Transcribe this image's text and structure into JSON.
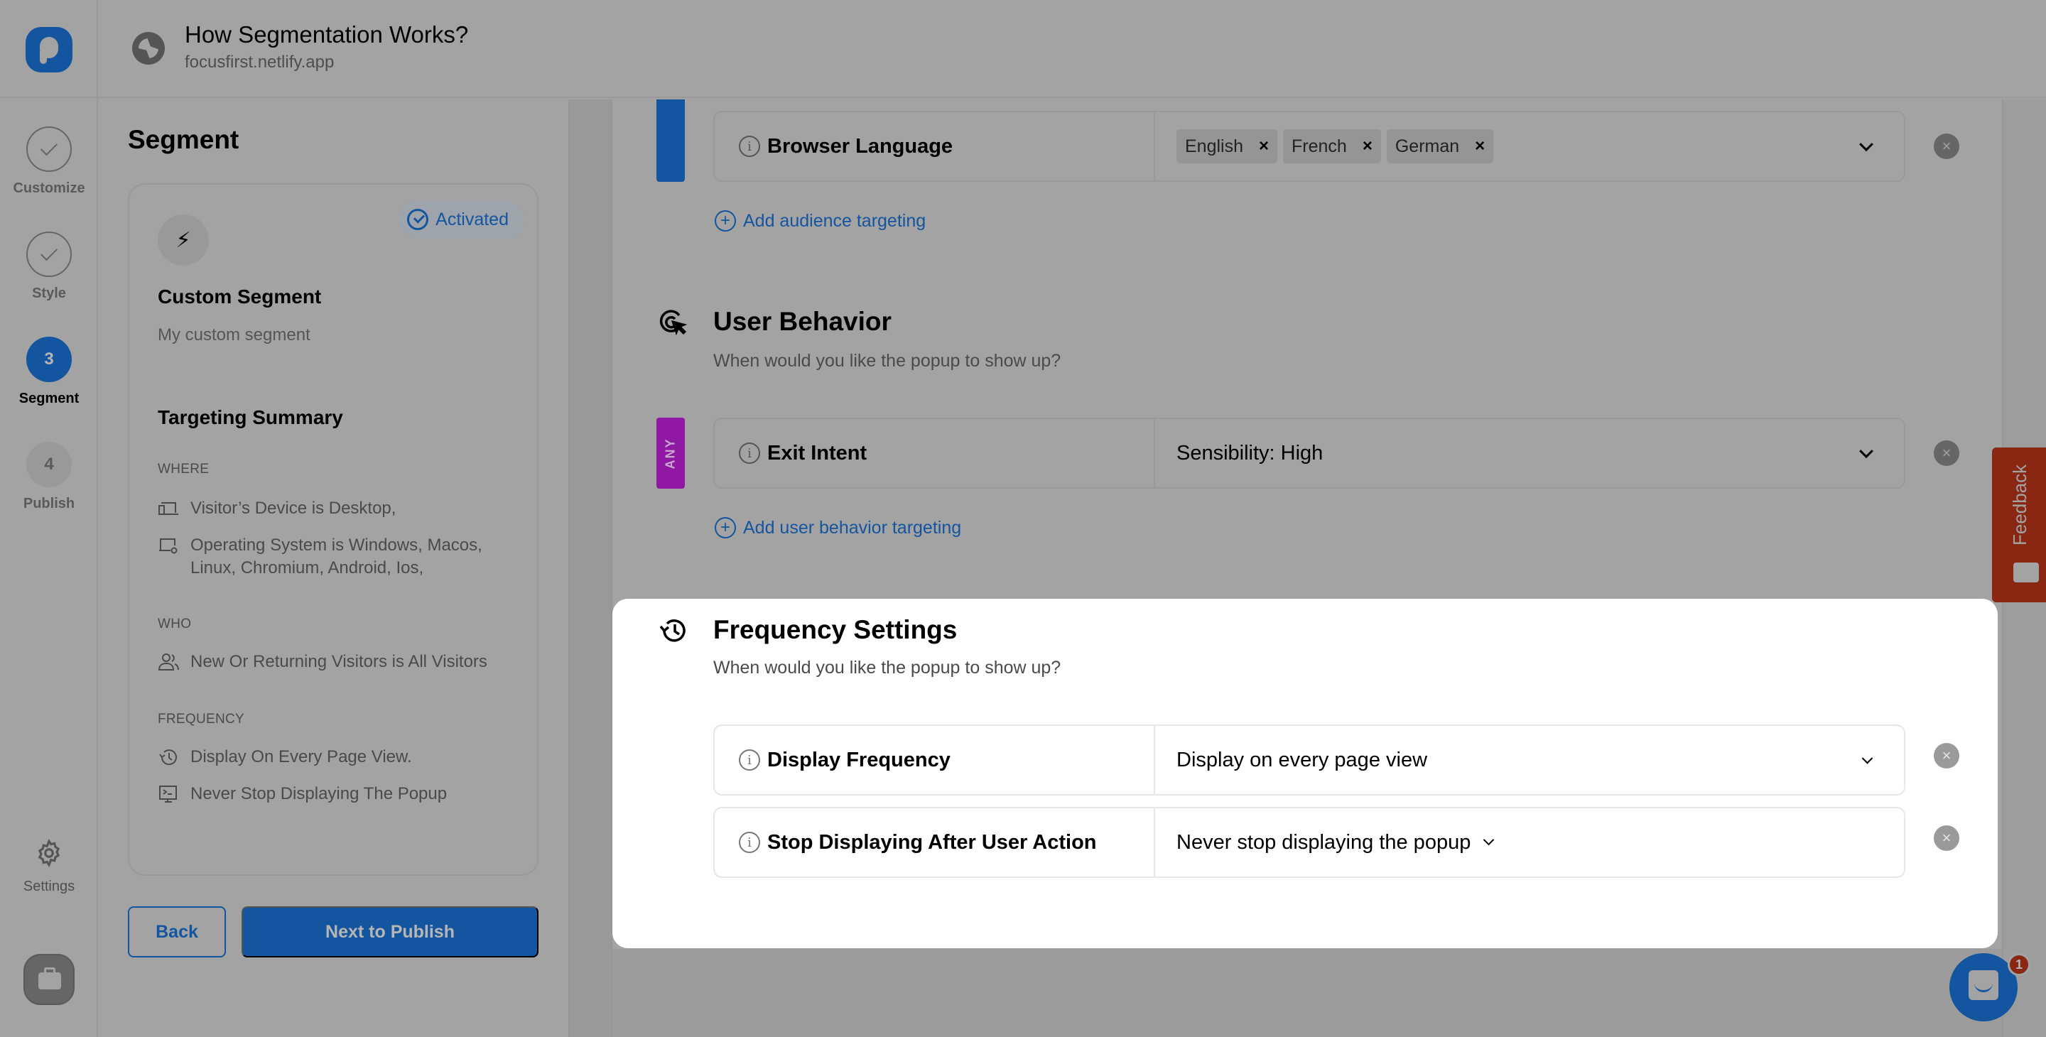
{
  "header": {
    "title": "How Segmentation Works?",
    "url": "focusfirst.netlify.app"
  },
  "rail": {
    "steps": [
      {
        "label": "Customize",
        "state": "done",
        "marker": ""
      },
      {
        "label": "Style",
        "state": "done",
        "marker": ""
      },
      {
        "label": "Segment",
        "state": "active",
        "marker": "3"
      },
      {
        "label": "Publish",
        "state": "todo",
        "marker": "4"
      }
    ],
    "settings_label": "Settings"
  },
  "segment_panel": {
    "title": "Segment",
    "card": {
      "status": "Activated",
      "name": "Custom Segment",
      "description": "My custom segment",
      "summary_title": "Targeting Summary",
      "sections": [
        {
          "heading": "WHERE",
          "items": [
            {
              "icon": "devices-icon",
              "text": "Visitor’s Device is Desktop,"
            },
            {
              "icon": "os-settings-icon",
              "text": "Operating System is Windows, Macos, Linux, Chromium, Android, Ios,"
            }
          ]
        },
        {
          "heading": "WHO",
          "items": [
            {
              "icon": "users-icon",
              "text": "New Or Returning Visitors is All Visitors"
            }
          ]
        },
        {
          "heading": "FREQUENCY",
          "items": [
            {
              "icon": "history-icon",
              "text": "Display On Every Page View."
            },
            {
              "icon": "terminal-monitor-icon",
              "text": "Never Stop Displaying The Popup"
            }
          ]
        }
      ]
    },
    "back_label": "Back",
    "next_label": "Next to Publish"
  },
  "main": {
    "audience": {
      "rule": {
        "label": "Browser Language",
        "chips": [
          "English",
          "French",
          "German"
        ],
        "chip_remove": "×"
      },
      "add_label": "Add audience targeting"
    },
    "user_behavior": {
      "title": "User Behavior",
      "subtitle": "When would you like the popup to show up?",
      "operator": "ANY",
      "rule": {
        "label": "Exit Intent",
        "value": "Sensibility: High"
      },
      "add_label": "Add user behavior targeting"
    },
    "frequency": {
      "title": "Frequency Settings",
      "subtitle": "When would you like the popup to show up?",
      "rules": [
        {
          "label": "Display Frequency",
          "value": "Display on every page view"
        },
        {
          "label": "Stop Displaying After User Action",
          "value": "Never stop displaying the popup"
        }
      ]
    },
    "remove_symbol": "×"
  },
  "widgets": {
    "feedback_label": "Feedback",
    "chat_badge": "1"
  },
  "colors": {
    "primary": "#1455a0",
    "any_operator": "#8f19a3",
    "feedback": "#8a2713"
  }
}
